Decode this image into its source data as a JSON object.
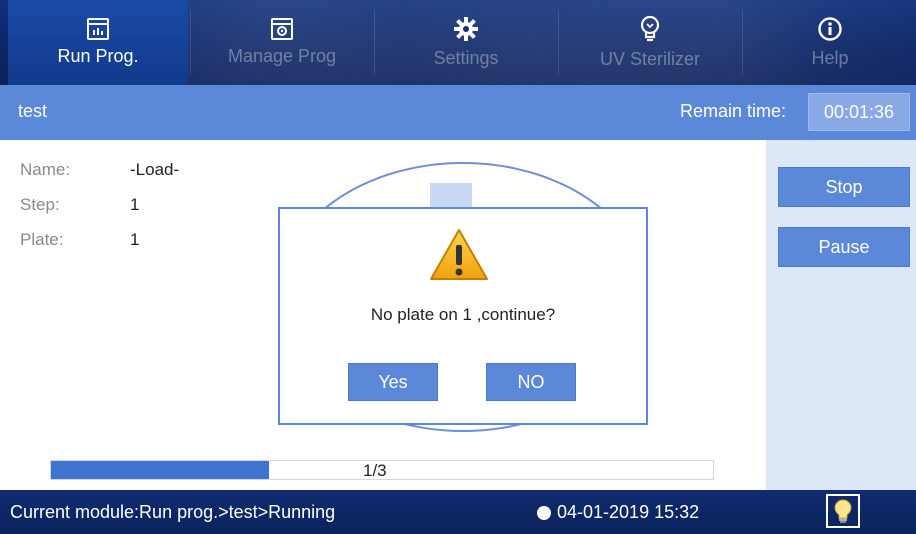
{
  "nav": {
    "tabs": [
      {
        "label": "Run Prog.",
        "icon": "run-prog-icon",
        "active": true
      },
      {
        "label": "Manage Prog",
        "icon": "manage-prog-icon",
        "active": false
      },
      {
        "label": "Settings",
        "icon": "gear-icon",
        "active": false
      },
      {
        "label": "UV Sterilizer",
        "icon": "uv-bulb-icon",
        "active": false
      },
      {
        "label": "Help",
        "icon": "info-icon",
        "active": false
      }
    ]
  },
  "header": {
    "program_name": "test",
    "remain_label": "Remain time:",
    "remain_value": "00:01:36"
  },
  "info": {
    "name_label": "Name:",
    "name_value": "-Load-",
    "step_label": "Step:",
    "step_value": "1",
    "plate_label": "Plate:",
    "plate_value": "1"
  },
  "controls": {
    "stop_label": "Stop",
    "pause_label": "Pause"
  },
  "dialog": {
    "message": "No plate on 1 ,continue?",
    "yes_label": "Yes",
    "no_label": "NO"
  },
  "progress": {
    "text": "1/3",
    "fraction": 0.33
  },
  "status": {
    "module_text": "Current module:Run prog.>test>Running",
    "datetime": "04-01-2019 15:32"
  },
  "colors": {
    "accent": "#5b88d9",
    "nav_bg": "#0a2466",
    "progress_fill": "#3f74cf",
    "warning": "#f2b21b"
  }
}
